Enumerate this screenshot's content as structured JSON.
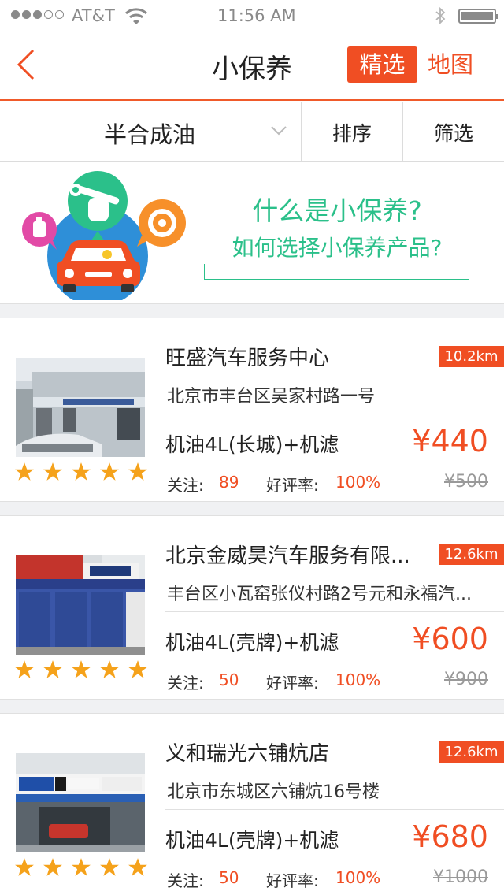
{
  "status_bar": {
    "carrier": "AT&T",
    "time": "11:56 AM",
    "signal_bars_filled": 3,
    "signal_bars_total": 5,
    "battery_level": 1.0,
    "icons": [
      "wifi-icon",
      "bluetooth-icon",
      "battery-icon"
    ]
  },
  "nav": {
    "title": "小保养",
    "tab_selected": "精选",
    "tab_map": "地图",
    "accent_color": "#f04e23"
  },
  "filters": {
    "oil": "半合成油",
    "sort": "排序",
    "screen": "筛选"
  },
  "promo": {
    "question1": "什么是小保养?",
    "question2": "如何选择小保养产品?",
    "color": "#2bc08a"
  },
  "shops": [
    {
      "name": "旺盛汽车服务中心",
      "distance": "10.2km",
      "address": "北京市丰台区吴家村路一号",
      "product": "机油4L(长城)+机滤",
      "price": "¥440",
      "original_price": "¥500",
      "follow_label": "关注:",
      "follow_count": "89",
      "rating_label": "好评率:",
      "rating": "100%",
      "stars": 5
    },
    {
      "name": "北京金威昊汽车服务有限...",
      "distance": "12.6km",
      "address": "丰台区小瓦窑张仪村路2号元和永福汽...",
      "product": "机油4L(壳牌)+机滤",
      "price": "¥600",
      "original_price": "¥900",
      "follow_label": "关注:",
      "follow_count": "50",
      "rating_label": "好评率:",
      "rating": "100%",
      "stars": 5
    },
    {
      "name": "义和瑞光六铺炕店",
      "distance": "12.6km",
      "address": "北京市东城区六铺炕16号楼",
      "product": "机油4L(壳牌)+机滤",
      "price": "¥680",
      "original_price": "¥1000",
      "follow_label": "关注:",
      "follow_count": "50",
      "rating_label": "好评率:",
      "rating": "100%",
      "stars": 5
    }
  ]
}
